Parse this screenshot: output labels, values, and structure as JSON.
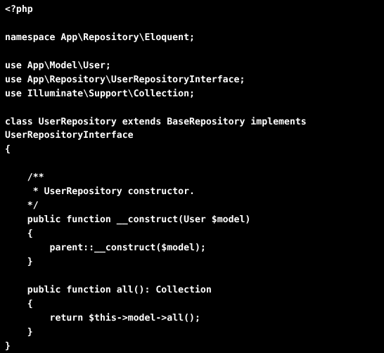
{
  "viewer": {
    "title": "PHP source code view",
    "background_color": "#000000",
    "text_color": "#ffffff",
    "language": "php",
    "font_style": "monospace-bold",
    "syntax_highlighting": "none"
  },
  "code": {
    "lines": [
      "<?php",
      "",
      "namespace App\\Repository\\Eloquent;",
      "",
      "use App\\Model\\User;",
      "use App\\Repository\\UserRepositoryInterface;",
      "use Illuminate\\Support\\Collection;",
      "",
      "class UserRepository extends BaseRepository implements",
      "UserRepositoryInterface",
      "{",
      "",
      "    /**",
      "     * UserRepository constructor.",
      "    */",
      "    public function __construct(User $model)",
      "    {",
      "        parent::__construct($model);",
      "    }",
      "",
      "    public function all(): Collection",
      "    {",
      "        return $this->model->all();",
      "    }",
      "}"
    ]
  }
}
